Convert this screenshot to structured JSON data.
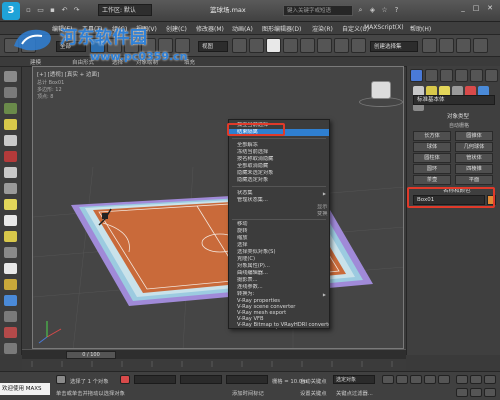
{
  "titlebar": {
    "workspace": "工作区: 默认",
    "title": "篮球场.max",
    "search_placeholder": "键入关键字或短语"
  },
  "menubar": {
    "items": [
      "编辑(E)",
      "工具(T)",
      "组(G)",
      "视图(V)",
      "创建(C)",
      "修改器(M)",
      "动画(A)",
      "图形编辑器(D)",
      "渲染(R)",
      "自定义(U)",
      "MAXScript(X)",
      "帮助(H)"
    ]
  },
  "toolbar": {
    "selection_filter": "全部",
    "view_dropdown": "视图",
    "named_selection": "创建选择集"
  },
  "ribbon": {
    "tabs": [
      "建模",
      "自由形式",
      "选择",
      "对象绘制",
      "填充"
    ]
  },
  "viewport": {
    "label": "[+] [透视] [真实 + 边面]",
    "stats": [
      "总计 Box01",
      "多边形: 12",
      "顶点: 8"
    ]
  },
  "context_menu": {
    "items": [
      {
        "label": "孤立当前选择",
        "highlight": false
      },
      {
        "label": "结束隔离",
        "highlight": true
      },
      {
        "label": "全部解冻",
        "highlight": false
      },
      {
        "label": "冻结当前选择",
        "highlight": false
      },
      {
        "label": "按名称取消隐藏",
        "highlight": false
      },
      {
        "label": "全部取消隐藏",
        "highlight": false
      },
      {
        "label": "隐藏未选定对象",
        "highlight": false
      },
      {
        "label": "隐藏选定对象",
        "highlight": false
      },
      {
        "label": "状态集",
        "highlight": false
      },
      {
        "label": "管理状态集...",
        "highlight": false
      },
      {
        "label": "移动",
        "highlight": false
      },
      {
        "label": "旋转",
        "highlight": false
      },
      {
        "label": "缩放",
        "highlight": false
      },
      {
        "label": "选择",
        "highlight": false
      },
      {
        "label": "选择类似对象(S)",
        "highlight": false
      },
      {
        "label": "克隆(C)",
        "highlight": false
      },
      {
        "label": "对象属性(P)...",
        "highlight": false
      },
      {
        "label": "曲线编辑器...",
        "highlight": false
      },
      {
        "label": "摄影表...",
        "highlight": false
      },
      {
        "label": "连线参数...",
        "highlight": false
      },
      {
        "label": "转换为:",
        "highlight": false
      },
      {
        "label": "V-Ray properties",
        "highlight": false
      },
      {
        "label": "V-Ray scene converter",
        "highlight": false
      },
      {
        "label": "V-Ray mesh export",
        "highlight": false
      },
      {
        "label": "V-Ray VFB",
        "highlight": false
      },
      {
        "label": "V-Ray Bitmap to VRayHDRI converter",
        "highlight": false
      },
      {
        "label": ".vrscene exporter",
        "highlight": false
      }
    ],
    "quad_labels": [
      "显示",
      "变换",
      "工具1",
      "工具2"
    ]
  },
  "command_panel": {
    "category": "标准基本体",
    "object_type_title": "对象类型",
    "autogrid": "自动栅格",
    "objects": [
      "长方体",
      "圆锥体",
      "球体",
      "几何球体",
      "圆柱体",
      "管状体",
      "圆环",
      "四棱锥",
      "茶壶",
      "平面"
    ],
    "name_color_title": "名称和颜色",
    "object_name": "Box01",
    "object_color": "#e08a36"
  },
  "timeline": {
    "frame": "0 / 100"
  },
  "statusbar": {
    "welcome": "欢迎使用 MAXS",
    "selected": "选择了 1 个对象",
    "hint": "单击或单击并拖动以选择对象",
    "grid": "栅格 = 10.0m",
    "add_time_tag": "添加时间标记",
    "auto_key": "自动关键点",
    "selected_object": "选定对象",
    "set_key": "设置关键点",
    "key_filter": "关键点过滤器..."
  },
  "watermark": {
    "site": "河东软件园",
    "url": "www.pc0359.cn"
  }
}
